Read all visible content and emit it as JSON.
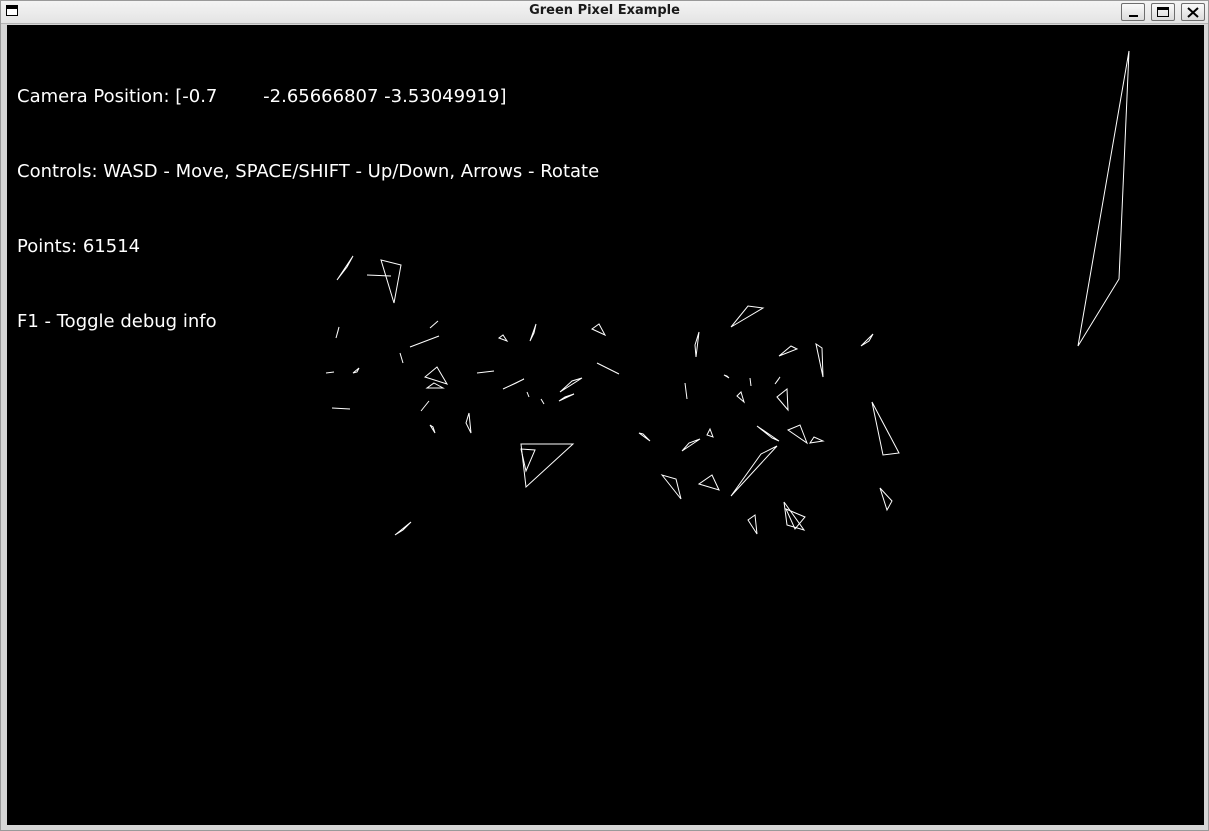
{
  "window": {
    "title": "Green Pixel Example"
  },
  "hud": {
    "camera_position": "Camera Position: [-0.7        -2.65666807 -3.53049919]",
    "controls": "Controls: WASD - Move, SPACE/SHIFT - Up/Down, Arrows - Rotate",
    "points": "Points: 61514",
    "debug_toggle": "F1 - Toggle debug info"
  },
  "colors": {
    "background": "#000000",
    "foreground": "#ffffff"
  }
}
